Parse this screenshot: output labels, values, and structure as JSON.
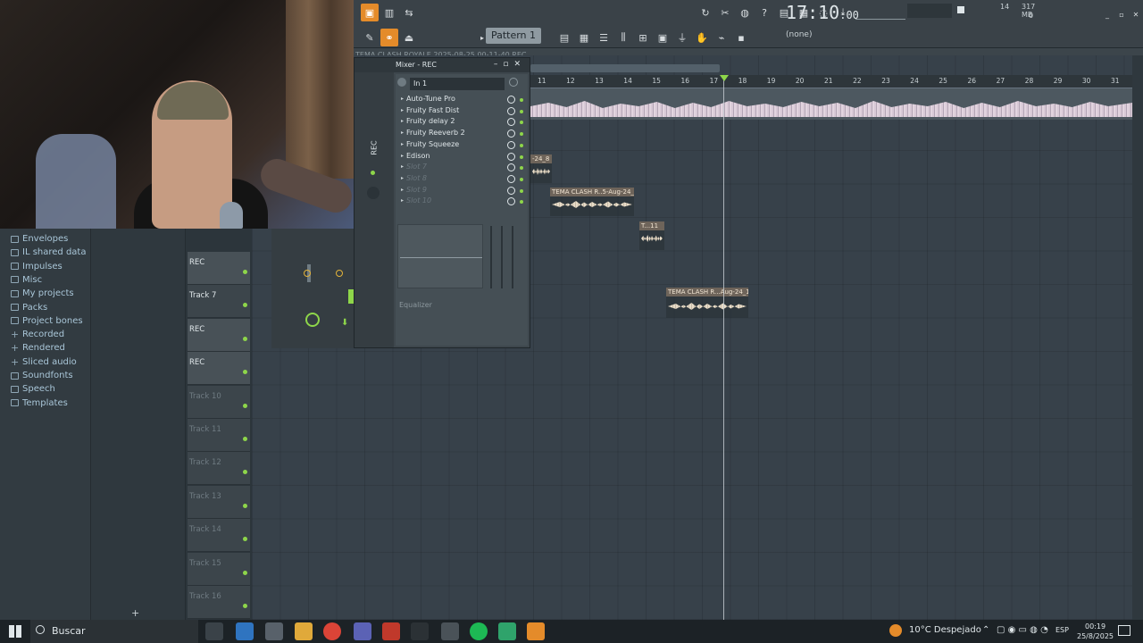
{
  "toolbar": {
    "time_main": "17:10",
    "time_sub": ":00",
    "pattern_label": "Pattern 1",
    "none_label": "(none)",
    "cpu_value": "14",
    "mem_value": "317 MB",
    "voice_count": "0"
  },
  "playlist": {
    "title": "TEMA CLASH ROYALE 2025-08-25 00-11-40 REC",
    "ruler_numbers": [
      "11",
      "12",
      "13",
      "14",
      "15",
      "16",
      "17",
      "18",
      "19",
      "20",
      "21",
      "22",
      "23",
      "24",
      "25",
      "26",
      "27",
      "28",
      "29",
      "30",
      "31"
    ],
    "clips": [
      {
        "label": "-24_8"
      },
      {
        "label": "TEMA CLASH R..5-Aug-24_8"
      },
      {
        "label": "T...11"
      },
      {
        "label": "TEMA CLASH R...Aug-24_12"
      }
    ]
  },
  "mixer": {
    "title": "Mixer - REC",
    "input": "In 1",
    "slots": [
      {
        "name": "Auto-Tune Pro",
        "empty": false
      },
      {
        "name": "Fruity Fast Dist",
        "empty": false
      },
      {
        "name": "Fruity delay 2",
        "empty": false
      },
      {
        "name": "Fruity Reeverb 2",
        "empty": false
      },
      {
        "name": "Fruity Squeeze",
        "empty": false
      },
      {
        "name": "Edison",
        "empty": false
      },
      {
        "name": "Slot 7",
        "empty": true
      },
      {
        "name": "Slot 8",
        "empty": true
      },
      {
        "name": "Slot 9",
        "empty": true
      },
      {
        "name": "Slot 10",
        "empty": true
      }
    ],
    "eq_label": "Equalizer",
    "strip_label": "REC"
  },
  "browser": {
    "items": [
      {
        "label": "Envelopes",
        "icon": "folder-icon"
      },
      {
        "label": "IL shared data",
        "icon": "folder-icon"
      },
      {
        "label": "Impulses",
        "icon": "folder-icon"
      },
      {
        "label": "Misc",
        "icon": "folder-icon"
      },
      {
        "label": "My projects",
        "icon": "folder-icon"
      },
      {
        "label": "Packs",
        "icon": "folder-icon"
      },
      {
        "label": "Project bones",
        "icon": "folder-icon"
      },
      {
        "label": "Recorded",
        "icon": "plus-icon"
      },
      {
        "label": "Rendered",
        "icon": "plus-icon"
      },
      {
        "label": "Sliced audio",
        "icon": "plus-icon"
      },
      {
        "label": "Soundfonts",
        "icon": "folder-icon"
      },
      {
        "label": "Speech",
        "icon": "folder-icon"
      },
      {
        "label": "Templates",
        "icon": "folder-icon"
      }
    ]
  },
  "tracks": [
    {
      "label": "REC",
      "rec": true
    },
    {
      "label": "Track 7",
      "rec": false
    },
    {
      "label": "REC",
      "rec": true
    },
    {
      "label": "REC",
      "rec": true
    },
    {
      "label": "Track 10",
      "rec": false,
      "dim": true
    },
    {
      "label": "Track 11",
      "rec": false,
      "dim": true
    },
    {
      "label": "Track 12",
      "rec": false,
      "dim": true
    },
    {
      "label": "Track 13",
      "rec": false,
      "dim": true
    },
    {
      "label": "Track 14",
      "rec": false,
      "dim": true
    },
    {
      "label": "Track 15",
      "rec": false,
      "dim": true
    },
    {
      "label": "Track 16",
      "rec": false,
      "dim": true
    }
  ],
  "taskbar": {
    "search_placeholder": "Buscar",
    "weather": "10°C  Despejado",
    "language": "ESP",
    "time": "00:19",
    "date": "25/8/2025"
  },
  "colors": {
    "accent_orange": "#e48b2a",
    "led_green": "#8ed64a",
    "playlist_bg": "#37414a"
  }
}
